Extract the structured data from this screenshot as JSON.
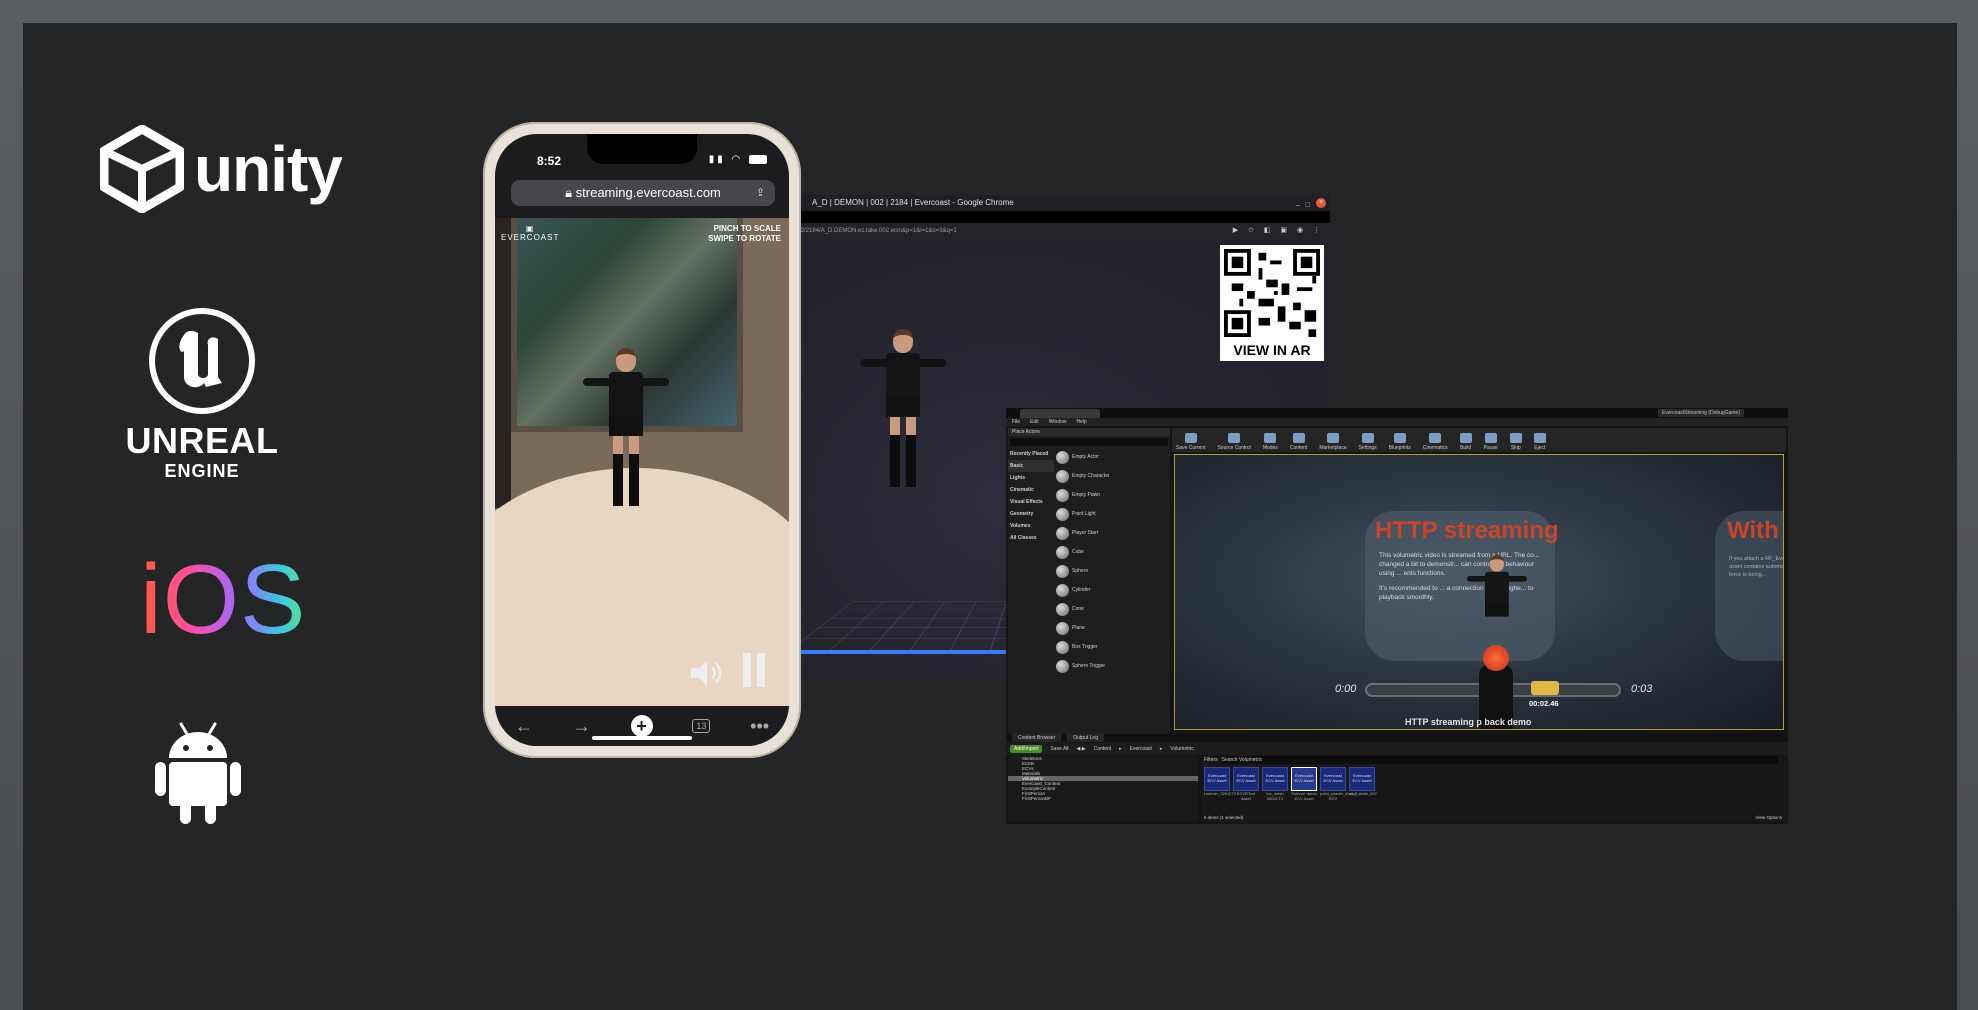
{
  "logos": {
    "unity": "unity",
    "unreal": "UNREAL",
    "engine": "ENGINE",
    "ios": "iOS",
    "android_icon": "android-robot-icon"
  },
  "phone": {
    "time": "8:52",
    "url": "streaming.evercoast.com",
    "brand": "EVERCOAST",
    "hint_line1": "PINCH TO SCALE",
    "hint_line2": "SWIPE TO ROTATE",
    "tab_count": "13",
    "more": "•••"
  },
  "chrome": {
    "title": "A_D | DEMON | 002 | 2184 | Evercoast - Google Chrome",
    "url": "002/2184/A_D.DEMON.ec.take.002.ecm&p=1&l=1&o=3&q=1",
    "qr_label": "VIEW IN AR"
  },
  "unreal_editor": {
    "project": "EvercoastStreaming (DebugGame)",
    "menu": [
      "File",
      "Edit",
      "Window",
      "Help"
    ],
    "place_actors": "Place Actors",
    "categories": [
      "Recently Placed",
      "Basic",
      "Lights",
      "Cinematic",
      "Visual Effects",
      "Geometry",
      "Volumes",
      "All Classes"
    ],
    "items": [
      "Empty Actor",
      "Empty Character",
      "Empty Pawn",
      "Point Light",
      "Player Start",
      "Cube",
      "Sphere",
      "Cylinder",
      "Cone",
      "Plane",
      "Box Trigger",
      "Sphere Trigger"
    ],
    "toolbar": [
      "Save Current",
      "Source Control",
      "Modes",
      "Content",
      "Marketplace",
      "Settings",
      "Blueprints",
      "Cinematics",
      "Build",
      "Pause",
      "Skip",
      "Eject"
    ],
    "viewport": {
      "heading": "HTTP streaming",
      "heading2": "With",
      "desc": "This volumetric video is streamed from a URL. The co... changed a bit to demonstr... can control the behaviour using ... ents functions.",
      "desc_2": "It's recommended to ... a connection speed highe... to playback smoothly.",
      "desc_right": "If you attach a RF_Evercoast... asset contains automatically... force is being...",
      "time_start": "0:00",
      "time_end": "0:03",
      "time_current": "00:02.46",
      "caption": "HTTP streaming  p   back demo"
    },
    "bottom_tabs": [
      "Content Browser",
      "Output Log"
    ],
    "cb_bar": {
      "add": "Add/Import",
      "save_all": "Save All",
      "path": [
        "Content",
        "Evercoast",
        "Volumetric"
      ]
    },
    "tree": [
      "Skeletons",
      "ECMs",
      "ECVs",
      "Materials",
      "Volumetric",
      "Evercoast_Content",
      "ExampleContent",
      "FirstPerson",
      "FirstPersonBP"
    ],
    "filters": "Filters",
    "search_placeholder": "Search Volumetric",
    "tiles": [
      {
        "img": "Evercoast ECV Asset",
        "name": "Listener_02KICT2"
      },
      {
        "img": "Evercoast ECV Asset",
        "name": "ECVRTest asset"
      },
      {
        "img": "Evercoast ECV Asset",
        "name": "ice_mesh 0004CT2"
      },
      {
        "img": "Evercoast ECV Asset",
        "name": "Rollover demo ECV Asset"
      },
      {
        "img": "Evercoast ECV Asset",
        "name": "point_shader_shot_2 ECV"
      },
      {
        "img": "Evercoast ECV Asset",
        "name": "vivo_skate_007"
      }
    ],
    "item_count": "6 items (1 selected)",
    "view_options": "View Options"
  }
}
